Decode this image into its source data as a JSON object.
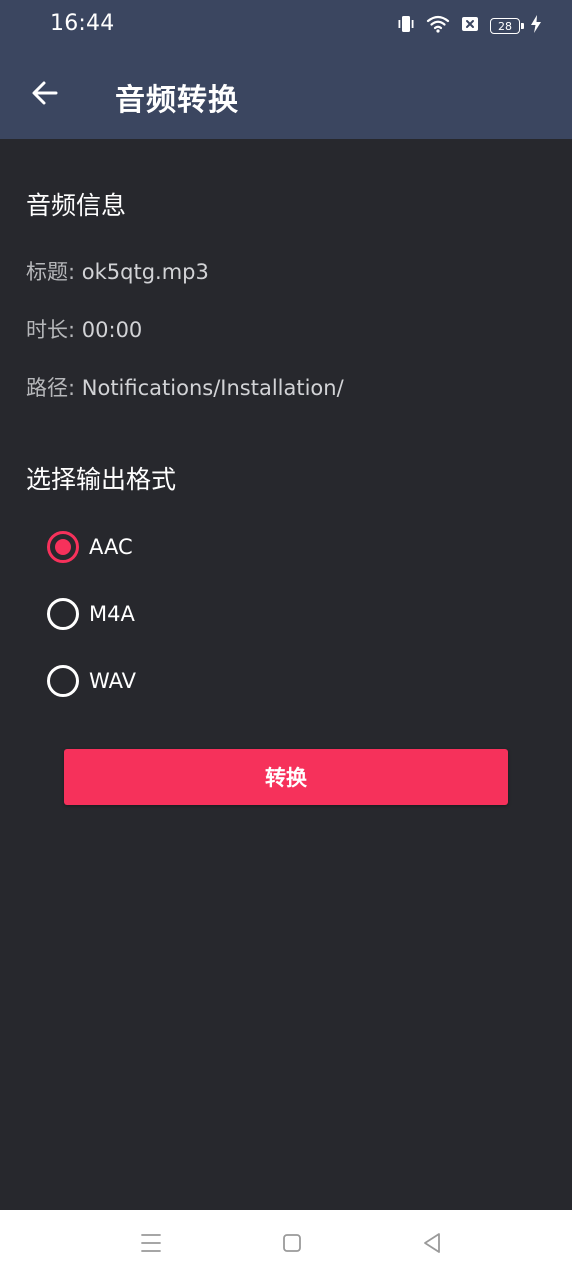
{
  "status_bar": {
    "time": "16:44",
    "battery_level": "28",
    "icons": [
      "vibrate-icon",
      "wifi-icon",
      "close-box-icon",
      "battery-icon",
      "charging-icon"
    ]
  },
  "header": {
    "title": "音频转换",
    "back_icon": "arrow-left-icon"
  },
  "audio_info": {
    "section_title": "音频信息",
    "rows": [
      {
        "label": "标题:",
        "value": "ok5qtg.mp3"
      },
      {
        "label": "时长:",
        "value": "00:00"
      },
      {
        "label": "路径:",
        "value": "Notifications/Installation/"
      }
    ]
  },
  "output_format": {
    "section_title": "选择输出格式",
    "options": [
      {
        "label": "AAC",
        "selected": true
      },
      {
        "label": "M4A",
        "selected": false
      },
      {
        "label": "WAV",
        "selected": false
      }
    ]
  },
  "convert_button": {
    "label": "转换"
  },
  "nav_bar": {
    "icons": [
      "menu-icon",
      "home-square-icon",
      "back-triangle-icon"
    ]
  },
  "colors": {
    "accent": "#f6315b",
    "app_bar": "#3b4660",
    "background": "#27282d"
  }
}
